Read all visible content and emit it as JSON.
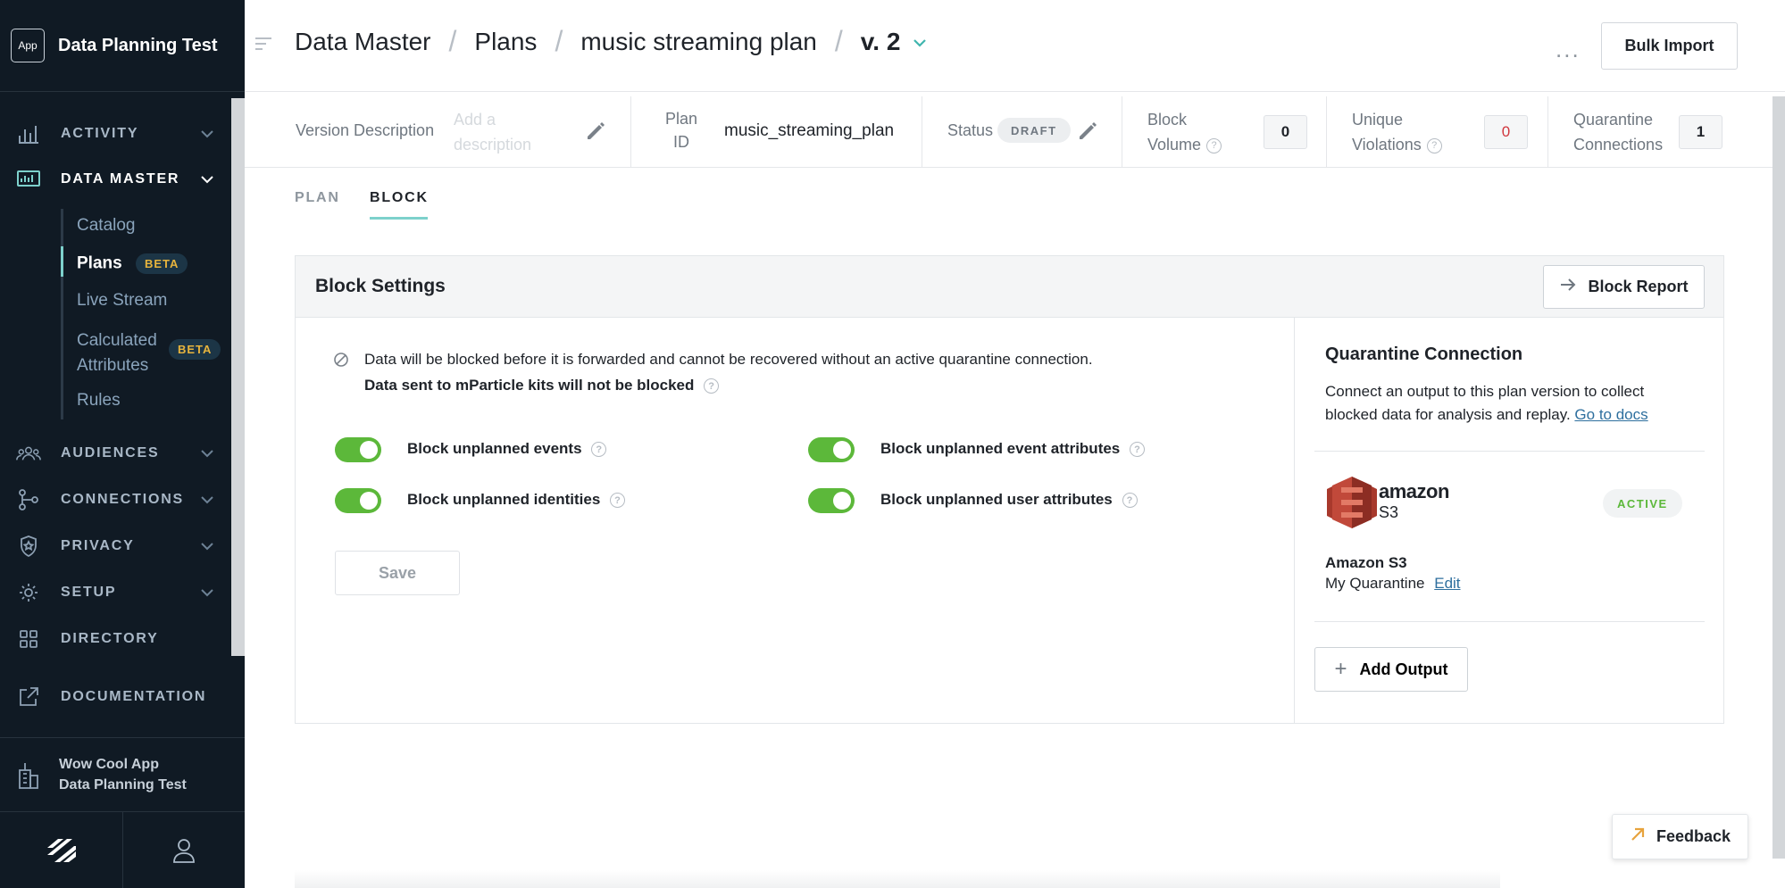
{
  "app": {
    "badge": "App",
    "name": "Data Planning Test"
  },
  "nav": {
    "activity": "ACTIVITY",
    "data_master": "DATA MASTER",
    "sub": {
      "catalog": "Catalog",
      "plans": "Plans",
      "plans_badge": "BETA",
      "live_stream": "Live Stream",
      "calc_attr_1": "Calculated",
      "calc_attr_2": "Attributes",
      "calc_badge": "BETA",
      "rules": "Rules"
    },
    "audiences": "AUDIENCES",
    "connections": "CONNECTIONS",
    "privacy": "PRIVACY",
    "setup": "SETUP",
    "directory": "DIRECTORY",
    "documentation": "DOCUMENTATION"
  },
  "workspace": {
    "line1": "Wow Cool App",
    "line2": "Data Planning Test"
  },
  "header": {
    "crumbs": [
      "Data Master",
      "Plans",
      "music streaming plan"
    ],
    "version": "v. 2",
    "more": "...",
    "bulk_import": "Bulk Import"
  },
  "info": {
    "version_desc_label": "Version Description",
    "version_desc_placeholder_1": "Add a",
    "version_desc_placeholder_2": "description",
    "plan_id_label_1": "Plan",
    "plan_id_label_2": "ID",
    "plan_id": "music_streaming_plan",
    "status_label": "Status",
    "status": "DRAFT",
    "block_volume_1": "Block",
    "block_volume_2": "Volume",
    "block_volume": "0",
    "unique_violations_1": "Unique",
    "unique_violations_2": "Violations",
    "unique_violations": "0",
    "quarantine_1": "Quarantine",
    "quarantine_2": "Connections",
    "quarantine": "1"
  },
  "tabs": {
    "plan": "PLAN",
    "block": "BLOCK"
  },
  "block": {
    "title": "Block Settings",
    "report_button": "Block Report",
    "notice": "Data will be blocked before it is forwarded and cannot be recovered without an active quarantine connection.",
    "notice_bold": "Data sent to mParticle kits will not be blocked",
    "toggles": [
      {
        "label": "Block unplanned events",
        "on": true
      },
      {
        "label": "Block unplanned event attributes",
        "on": true
      },
      {
        "label": "Block unplanned identities",
        "on": true
      },
      {
        "label": "Block unplanned user attributes",
        "on": true
      }
    ],
    "save": "Save"
  },
  "quarantine": {
    "title": "Quarantine Connection",
    "desc": "Connect an output to this plan version to collect blocked data for analysis and replay.",
    "docs_link": "Go to docs",
    "logo_word": "amazon",
    "logo_sub": "S3",
    "status": "ACTIVE",
    "output_name": "Amazon S3",
    "output_config": "My Quarantine",
    "edit": "Edit",
    "add_output": "Add Output"
  },
  "feedback": "Feedback",
  "colors": {
    "sidebar": "#101a24",
    "toggle_on": "#5cb83a",
    "accent_teal": "#7dd1cc",
    "beta": "#e7b43d",
    "violations": "#d0363d"
  }
}
